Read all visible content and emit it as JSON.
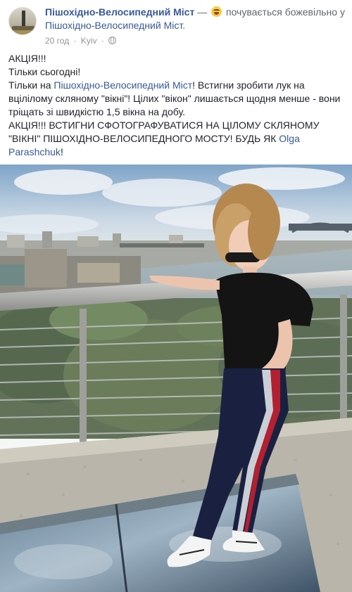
{
  "post": {
    "page_name": "Пішохідно-Велосипедний Міст",
    "separator": "—",
    "feeling_text": "почувається божевільно у",
    "place": "Пішохідно-Велосипедний Міст",
    "place_suffix": ".",
    "time": "20 год",
    "dot": "·",
    "location": "Kyiv",
    "dot2": "·",
    "privacy_icon": "globe-icon",
    "feeling_icon": "crazy-face-emoji"
  },
  "text": {
    "line1": "АКЦІЯ!!!",
    "line2": "Тільки сьогодні!",
    "line3_prefix": "Тільки на ",
    "line3_link": "Пішохідно-Велосипедний Міст",
    "line3_rest": "! Встигни зробити лук на вцілілому скляному \"вікні\"! Цілих \"вікон\" лишається щодня менше - вони тріщать зі швидкістю 1,5 вікна на добу.",
    "line4_prefix": "АКЦІЯ!!! ВСТИГНИ СФОТОГРАФУВАТИСЯ НА ЦІЛОМУ СКЛЯНОМУ \"ВІКНІ\" ПІШОХІДНО-ВЕЛОСИПЕДНОГО МОСТУ! БУДЬ ЯК ",
    "line4_link": "Olga Parashchuk",
    "line4_suffix": "!"
  },
  "colors": {
    "link": "#385898",
    "secondary": "#90949c",
    "text": "#1d2129"
  }
}
